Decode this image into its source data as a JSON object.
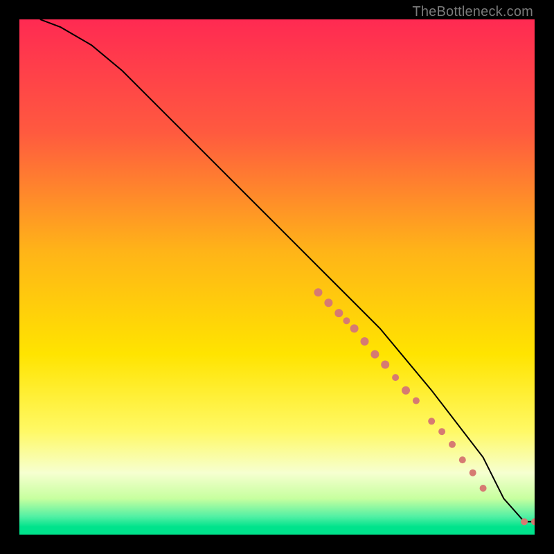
{
  "attribution": "TheBottleneck.com",
  "chart_data": {
    "type": "line",
    "title": "",
    "xlabel": "",
    "ylabel": "",
    "xlim": [
      0,
      100
    ],
    "ylim": [
      0,
      100
    ],
    "series": [
      {
        "name": "curve",
        "x": [
          4,
          8,
          14,
          20,
          30,
          40,
          50,
          60,
          70,
          80,
          90,
          94,
          98,
          100
        ],
        "y": [
          100,
          98.5,
          95,
          90,
          80,
          70,
          60,
          50,
          40,
          28,
          15,
          7,
          2.5,
          2.5
        ]
      }
    ],
    "markers": {
      "name": "cluster",
      "points": [
        {
          "x": 58,
          "y": 47,
          "r": 6
        },
        {
          "x": 60,
          "y": 45,
          "r": 6
        },
        {
          "x": 62,
          "y": 43,
          "r": 6
        },
        {
          "x": 63.5,
          "y": 41.5,
          "r": 5
        },
        {
          "x": 65,
          "y": 40,
          "r": 6
        },
        {
          "x": 67,
          "y": 37.5,
          "r": 6
        },
        {
          "x": 69,
          "y": 35,
          "r": 6
        },
        {
          "x": 71,
          "y": 33,
          "r": 6
        },
        {
          "x": 73,
          "y": 30.5,
          "r": 5
        },
        {
          "x": 75,
          "y": 28,
          "r": 6
        },
        {
          "x": 77,
          "y": 26,
          "r": 5
        },
        {
          "x": 80,
          "y": 22,
          "r": 5
        },
        {
          "x": 82,
          "y": 20,
          "r": 5
        },
        {
          "x": 84,
          "y": 17.5,
          "r": 5
        },
        {
          "x": 86,
          "y": 14.5,
          "r": 5
        },
        {
          "x": 88,
          "y": 12,
          "r": 5
        },
        {
          "x": 90,
          "y": 9,
          "r": 5
        },
        {
          "x": 98,
          "y": 2.5,
          "r": 5
        },
        {
          "x": 100,
          "y": 2.5,
          "r": 5
        }
      ],
      "color": "#d67a72"
    },
    "gradient_stops": [
      {
        "offset": 0,
        "color": "#ff2a52"
      },
      {
        "offset": 22,
        "color": "#ff5a3f"
      },
      {
        "offset": 45,
        "color": "#ffb418"
      },
      {
        "offset": 65,
        "color": "#ffe400"
      },
      {
        "offset": 80,
        "color": "#fff966"
      },
      {
        "offset": 88,
        "color": "#f6ffd0"
      },
      {
        "offset": 93,
        "color": "#c7ff9f"
      },
      {
        "offset": 96.5,
        "color": "#52f0a4"
      },
      {
        "offset": 98.5,
        "color": "#00e38c"
      },
      {
        "offset": 100,
        "color": "#00e38c"
      }
    ]
  }
}
